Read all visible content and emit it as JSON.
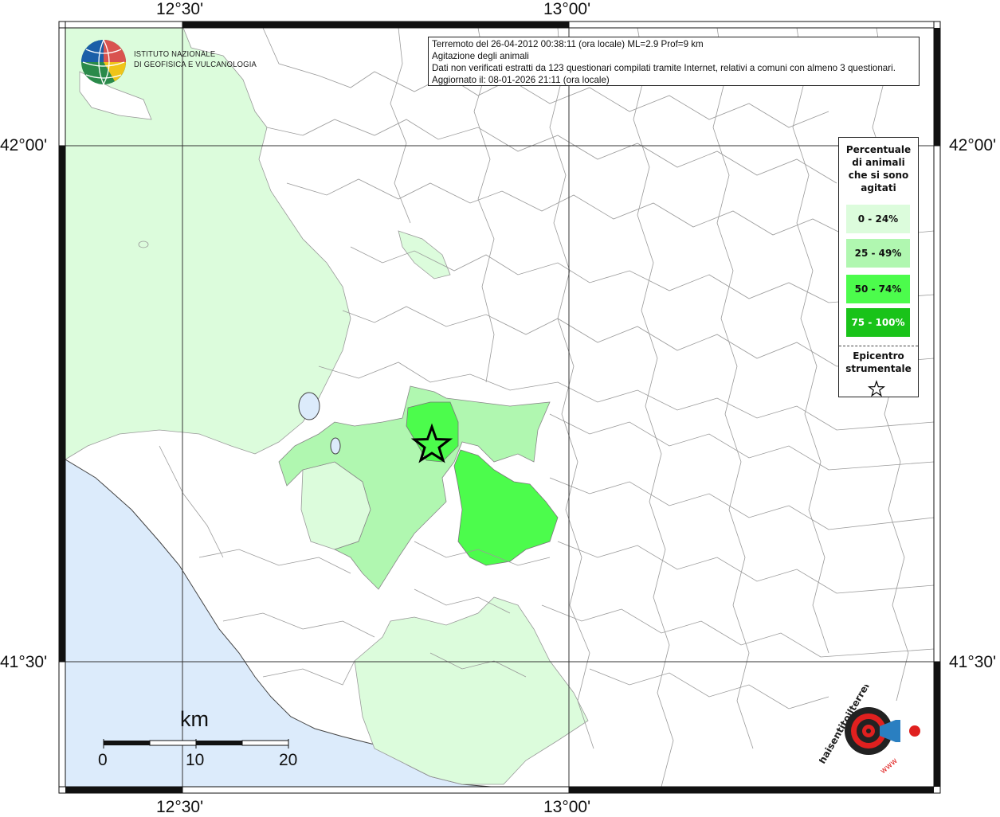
{
  "info": {
    "line1": "Terremoto del 26-04-2012 00:38:11 (ora locale) ML=2.9 Prof=9 km",
    "line2": "Agitazione degli animali",
    "line3": "Dati non verificati estratti da 123 questionari compilati tramite Internet, relativi a comuni con almeno 3 questionari.",
    "line4": "Aggiornato il: 08-01-2026 21:11 (ora locale)"
  },
  "logo": {
    "line1": "ISTITUTO NAZIONALE",
    "line2": "DI GEOFISICA E VULCANOLOGIA"
  },
  "coords": {
    "lon_left": "12°30'",
    "lon_right": "13°00'",
    "lat_top": "42°00'",
    "lat_bottom": "41°30'"
  },
  "legend": {
    "title_lines": [
      "Percentuale",
      "di animali",
      "che si sono",
      "agitati"
    ],
    "classes": [
      {
        "label": "0 - 24%",
        "color": "#dcfcdc"
      },
      {
        "label": "25 - 49%",
        "color": "#b0f7b0"
      },
      {
        "label": "50 - 74%",
        "color": "#4cfc4c"
      },
      {
        "label": "75 - 100%",
        "color": "#19c319"
      }
    ],
    "epicenter_lines": [
      "Epicentro",
      "strumentale"
    ]
  },
  "scale": {
    "unit": "km",
    "labels": [
      "0",
      "10",
      "20"
    ]
  },
  "colors": {
    "sea": "#dcebfb",
    "land": "#ffffff",
    "border": "#9a9a9a",
    "grid": "#333333"
  },
  "watermark": {
    "brand": "haisentitoilterremoto.it",
    "url": "www.haisentitoilterremoto.it"
  }
}
